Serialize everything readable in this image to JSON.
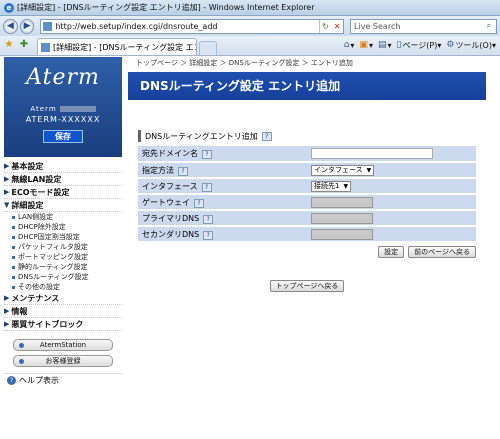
{
  "window": {
    "title": "[詳細設定] - [DNSルーティング設定 エントリ追加] - Windows Internet Explorer"
  },
  "address_bar": {
    "url": "http://web.setup/index.cgi/dnsroute_add",
    "search_placeholder": "Live Search"
  },
  "tab": {
    "title": "[詳細設定] - [DNSルーティング設定 エントリ..."
  },
  "toolbar": {
    "page": "ページ(P)",
    "tools": "ツール(O)"
  },
  "sidebar": {
    "logo": "Aterm",
    "model_line1": "Aterm",
    "model_line2": "ATERM-XXXXXX",
    "save": "保存",
    "menu": [
      {
        "label": "基本設定"
      },
      {
        "label": "無線LAN設定"
      },
      {
        "label": "ECOモード設定"
      },
      {
        "label": "詳細設定"
      }
    ],
    "submenu": [
      "LAN側設定",
      "DHCP除外設定",
      "DHCP固定割当設定",
      "パケットフィルタ設定",
      "ポートマッピング設定",
      "静的ルーティング設定",
      "DNSルーティング設定",
      "その他の設定"
    ],
    "menu2": [
      {
        "label": "メンテナンス"
      },
      {
        "label": "情報"
      },
      {
        "label": "悪質サイトブロック"
      }
    ],
    "buttons": [
      "AtermStation",
      "お客様登録"
    ],
    "help": "ヘルプ表示"
  },
  "main": {
    "breadcrumb": "トップページ ＞ 詳細設定 ＞ DNSルーティング設定 ＞ エントリ追加",
    "title": "DNSルーティング設定 エントリ追加",
    "section": "DNSルーティングエントリ追加",
    "help_mark": "?",
    "fields": [
      {
        "label": "宛先ドメイン名"
      },
      {
        "label": "指定方法",
        "value": "インタフェース"
      },
      {
        "label": "インタフェース",
        "value": "接続先1"
      },
      {
        "label": "ゲートウェイ"
      },
      {
        "label": "プライマリDNS"
      },
      {
        "label": "セカンダリDNS"
      }
    ],
    "set_button": "設定",
    "back_button": "前のページへ戻る",
    "top_button": "トップページへ戻る"
  }
}
